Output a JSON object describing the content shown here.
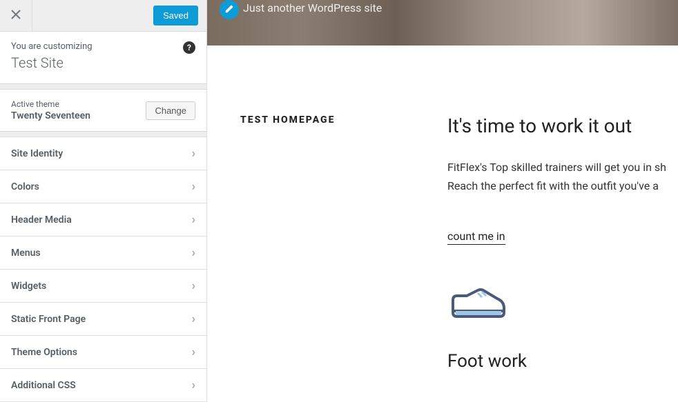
{
  "topbar": {
    "saved_label": "Saved"
  },
  "intro": {
    "customizing_label": "You are customizing",
    "site_title": "Test Site"
  },
  "theme": {
    "label": "Active theme",
    "name": "Twenty Seventeen",
    "change_label": "Change"
  },
  "menu_items": [
    {
      "label": "Site Identity"
    },
    {
      "label": "Colors"
    },
    {
      "label": "Header Media"
    },
    {
      "label": "Menus"
    },
    {
      "label": "Widgets"
    },
    {
      "label": "Static Front Page"
    },
    {
      "label": "Theme Options"
    },
    {
      "label": "Additional CSS"
    }
  ],
  "preview": {
    "tagline": "Just another WordPress site",
    "page_name": "TEST HOMEPAGE",
    "headline": "It's time to work it out",
    "body_line1": "FitFlex's Top skilled trainers will get you in sh",
    "body_line2": "Reach the perfect fit with the outfit you've a",
    "link_label": "count me in",
    "subhead": "Foot work"
  }
}
